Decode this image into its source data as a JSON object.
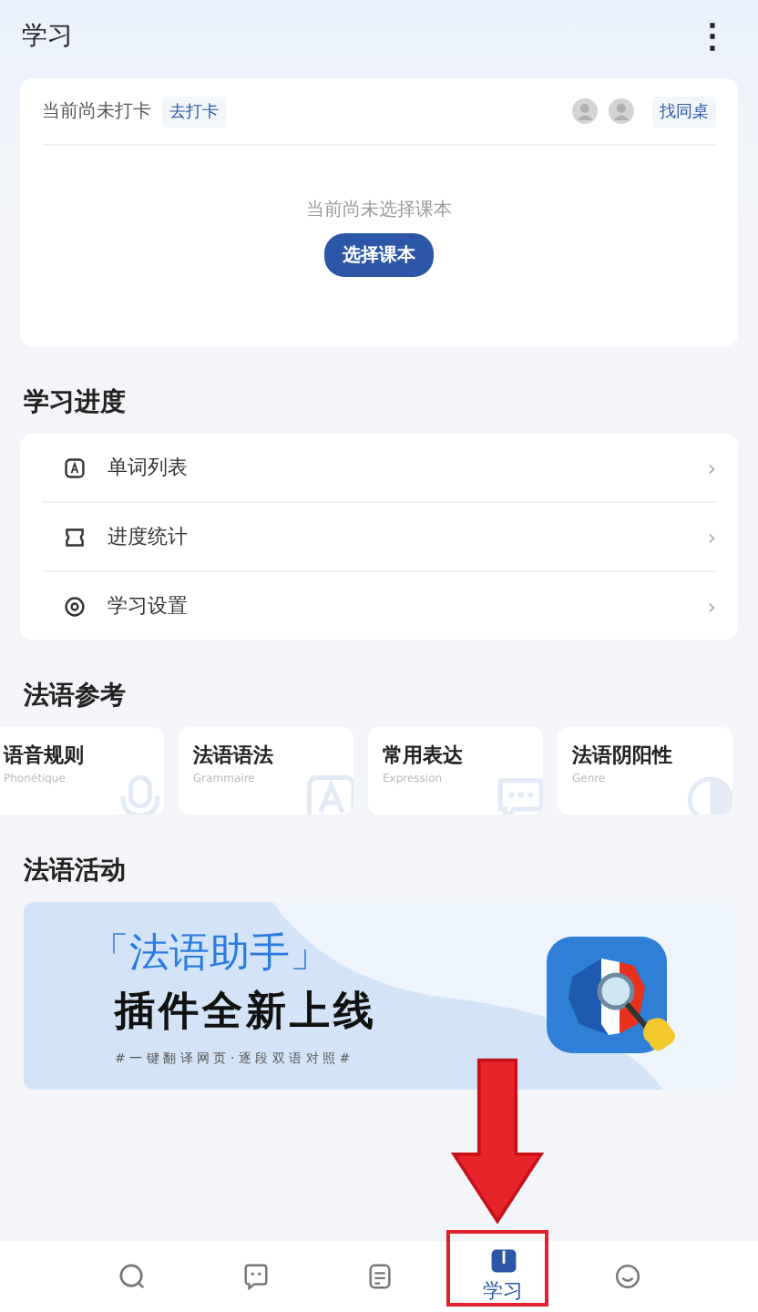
{
  "header": {
    "title": "学习",
    "menu_icon": "⋮"
  },
  "checkin": {
    "status": "当前尚未打卡",
    "action": "去打卡",
    "partner_link": "找同桌",
    "empty_text": "当前尚未选择课本",
    "choose_button": "选择课本"
  },
  "progress": {
    "title": "学习进度",
    "items": [
      {
        "label": "单词列表",
        "chevron": "›"
      },
      {
        "label": "进度统计",
        "chevron": "›"
      },
      {
        "label": "学习设置",
        "chevron": "›"
      }
    ]
  },
  "reference": {
    "title": "法语参考",
    "cards": [
      {
        "title": "语音规则",
        "subtitle": "Phonétique"
      },
      {
        "title": "法语语法",
        "subtitle": "Grammaire"
      },
      {
        "title": "常用表达",
        "subtitle": "Expression"
      },
      {
        "title": "法语阴阳性",
        "subtitle": "Genre"
      }
    ]
  },
  "activity": {
    "title": "法语活动",
    "banner": {
      "headline": "「法语助手」",
      "subline": "插件全新上线",
      "tagline": "# 一 键 翻 译 网 页 · 逐 段 双 语 对 照 #"
    }
  },
  "nav": [
    {
      "selected": false
    },
    {
      "selected": false
    },
    {
      "selected": false
    },
    {
      "label": "学习",
      "selected": true
    },
    {
      "selected": false
    }
  ]
}
